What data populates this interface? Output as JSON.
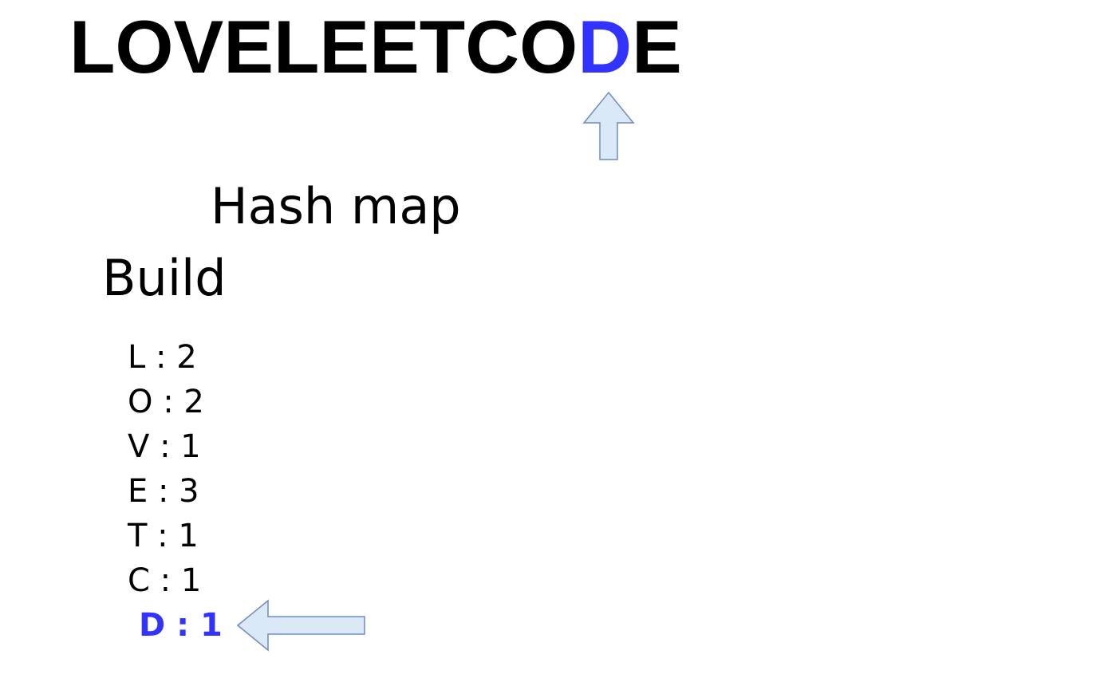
{
  "colors": {
    "text": "#000000",
    "highlight": "#3333ff",
    "arrow_fill": "#dae8f8",
    "arrow_stroke": "#6c8ebf"
  },
  "word": {
    "letters": [
      "L",
      "O",
      "V",
      "E",
      "L",
      "E",
      "E",
      "T",
      "C",
      "O",
      "D",
      "E"
    ],
    "highlight_index": 10
  },
  "hash_title": "Hash map",
  "build_title": "Build",
  "hash_map": [
    {
      "text": "L : 2",
      "highlighted": false
    },
    {
      "text": "O : 2",
      "highlighted": false
    },
    {
      "text": "V : 1",
      "highlighted": false
    },
    {
      "text": "E : 3",
      "highlighted": false
    },
    {
      "text": "T : 1",
      "highlighted": false
    },
    {
      "text": "C : 1",
      "highlighted": false
    },
    {
      "text": "D : 1",
      "highlighted": true
    }
  ],
  "icons": {
    "pointer_up": "arrow-up-icon",
    "pointer_left": "arrow-left-icon"
  }
}
